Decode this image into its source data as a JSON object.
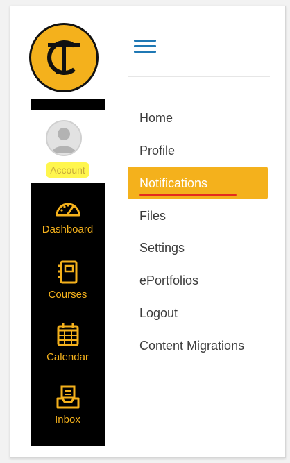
{
  "brand": {
    "logo_letters": "TC",
    "accent": "#f4b11c",
    "nav_bg": "#000000"
  },
  "account": {
    "label": "Account",
    "highlight": "#fff64d"
  },
  "global_nav": [
    {
      "label": "Dashboard",
      "icon": "dashboard-gauge-icon"
    },
    {
      "label": "Courses",
      "icon": "courses-book-icon"
    },
    {
      "label": "Calendar",
      "icon": "calendar-icon"
    },
    {
      "label": "Inbox",
      "icon": "inbox-tray-icon"
    }
  ],
  "menu": {
    "items": [
      "Home",
      "Profile",
      "Notifications",
      "Files",
      "Settings",
      "ePortfolios",
      "Logout",
      "Content Migrations"
    ],
    "active": "Notifications",
    "annotation_color": "#e52b1e"
  }
}
